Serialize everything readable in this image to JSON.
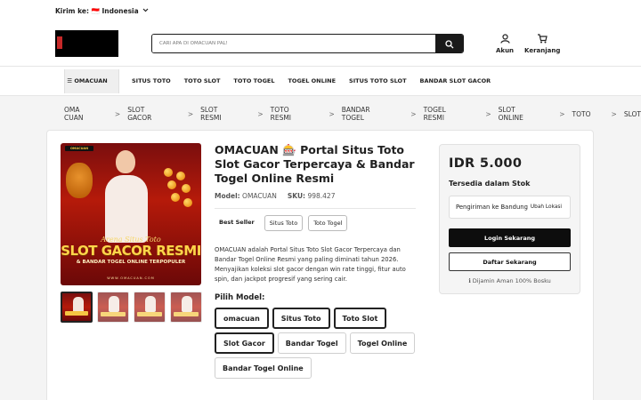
{
  "topbar": {
    "ship_to": "Kirim ke: 🇮🇩 Indonesia"
  },
  "header": {
    "search_placeholder": "CARI APA DI OMACUAN PAL!",
    "account_label": "Akun",
    "cart_label": "Keranjang"
  },
  "nav": {
    "menu_label": "☰ OMACUAN",
    "links": [
      "SITUS TOTO",
      "TOTO SLOT",
      "TOTO TOGEL",
      "TOGEL ONLINE",
      "SITUS TOTO SLOT",
      "BANDAR SLOT GACOR"
    ]
  },
  "breadcrumb": [
    "OMA CUAN",
    "SLOT GACOR",
    "SLOT RESMI",
    "TOTO RESMI",
    "BANDAR TOGEL",
    "TOGEL RESMI",
    "SLOT ONLINE",
    "TOTO",
    "SLOT"
  ],
  "product": {
    "title": "OMACUAN 🎰 Portal Situs Toto Slot Gacor Terpercaya & Bandar Togel Online Resmi",
    "model_label": "Model:",
    "model_value": "OMACUAN",
    "sku_label": "SKU:",
    "sku_value": "998.427",
    "tags": [
      "Best Seller",
      "Situs Toto",
      "Toto Togel"
    ],
    "description": "OMACUAN adalah Portal Situs Toto Slot Gacor Terpercaya dan Bandar Togel Online Resmi yang paling diminati tahun 2026. Menyajikan koleksi slot gacor dengan win rate tinggi, fitur auto spin, dan jackpot progresif yang sering cair.",
    "pick_label": "Pilih Model:",
    "options": [
      "omacuan",
      "Situs Toto",
      "Toto Slot",
      "Slot Gacor",
      "Bandar Togel",
      "Togel Online",
      "Bandar Togel Online"
    ],
    "image": {
      "brand": "OMACUAN",
      "script_text": "Arena Situs Toto",
      "headline": "SLOT GACOR RESMI",
      "subline": "& BANDAR TOGEL ONLINE TERPOPULER",
      "url": "WWW.OMACUAN.COM"
    }
  },
  "buybox": {
    "price": "IDR 5.000",
    "stock": "Tersedia dalam Stok",
    "shipping": "Pengiriman ke Bandung",
    "change_location": "Ubah Lokasi",
    "login_button": "Login Sekarang",
    "register_button": "Daftar Sekarang",
    "safe_note": "ℹ Dijamin Aman 100% Bosku"
  }
}
